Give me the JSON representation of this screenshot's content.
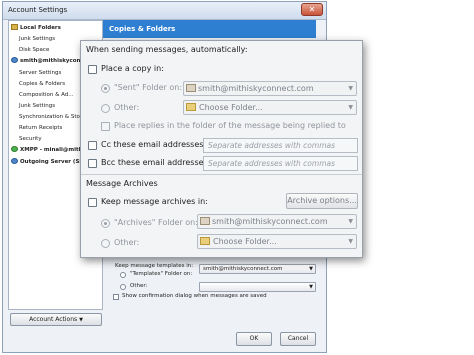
{
  "window": {
    "title": "Account Settings",
    "close_label": "✕",
    "account_actions_label": "Account Actions",
    "ok_label": "OK",
    "cancel_label": "Cancel"
  },
  "tree": {
    "items": [
      {
        "label": "Local Folders",
        "bold": true,
        "indent": 0,
        "icon": "folder-icon"
      },
      {
        "label": "Junk Settings",
        "indent": 1
      },
      {
        "label": "Disk Space",
        "indent": 1
      },
      {
        "label": "smith@mithiskyconnect.com",
        "bold": true,
        "indent": 0,
        "icon": "mail-account-icon"
      },
      {
        "label": "Server Settings",
        "indent": 1
      },
      {
        "label": "Copies & Folders",
        "indent": 1
      },
      {
        "label": "Composition & Ad...",
        "indent": 1
      },
      {
        "label": "Junk Settings",
        "indent": 1
      },
      {
        "label": "Synchronization & Sto...",
        "indent": 1
      },
      {
        "label": "Return Receipts",
        "indent": 1
      },
      {
        "label": "Security",
        "indent": 1
      },
      {
        "label": "XMPP - minali@mithisky...",
        "bold": true,
        "indent": 0,
        "icon": "chat-account-icon"
      },
      {
        "label": "Outgoing Server (SMTP)",
        "bold": true,
        "indent": 0,
        "icon": "smtp-icon"
      }
    ]
  },
  "panel": {
    "header": "Copies & Folders",
    "templates_heading": "Keep message templates in:",
    "templates_folder_label": "\"Templates\" Folder on:",
    "templates_folder_value": "smith@mithiskyconnect.com",
    "templates_other_label": "Other:",
    "show_confirmation_label": "Show confirmation dialog when messages are saved"
  },
  "zoom": {
    "sending_heading": "When sending messages, automatically:",
    "place_copy_label": "Place a copy in:",
    "sent_folder_label": "\"Sent\" Folder on:",
    "sent_folder_value": "smith@mithiskyconnect.com",
    "other_label": "Other:",
    "choose_folder": "Choose Folder...",
    "place_replies_label": "Place replies in the folder of the message being replied to",
    "cc_label": "Cc these email addresses:",
    "bcc_label": "Bcc these email addresses:",
    "address_placeholder": "Separate addresses with commas",
    "archives_heading": "Message Archives",
    "keep_archives_label": "Keep message archives in:",
    "archive_options_label": "Archive options...",
    "archives_folder_label": "\"Archives\" Folder on:",
    "archives_folder_value": "smith@mithiskyconnect.com",
    "archives_other_label": "Other:",
    "archives_choose_folder": "Choose Folder..."
  },
  "colors": {
    "header_blue": "#2e7fd2",
    "window_bg": "#eef1f6"
  }
}
